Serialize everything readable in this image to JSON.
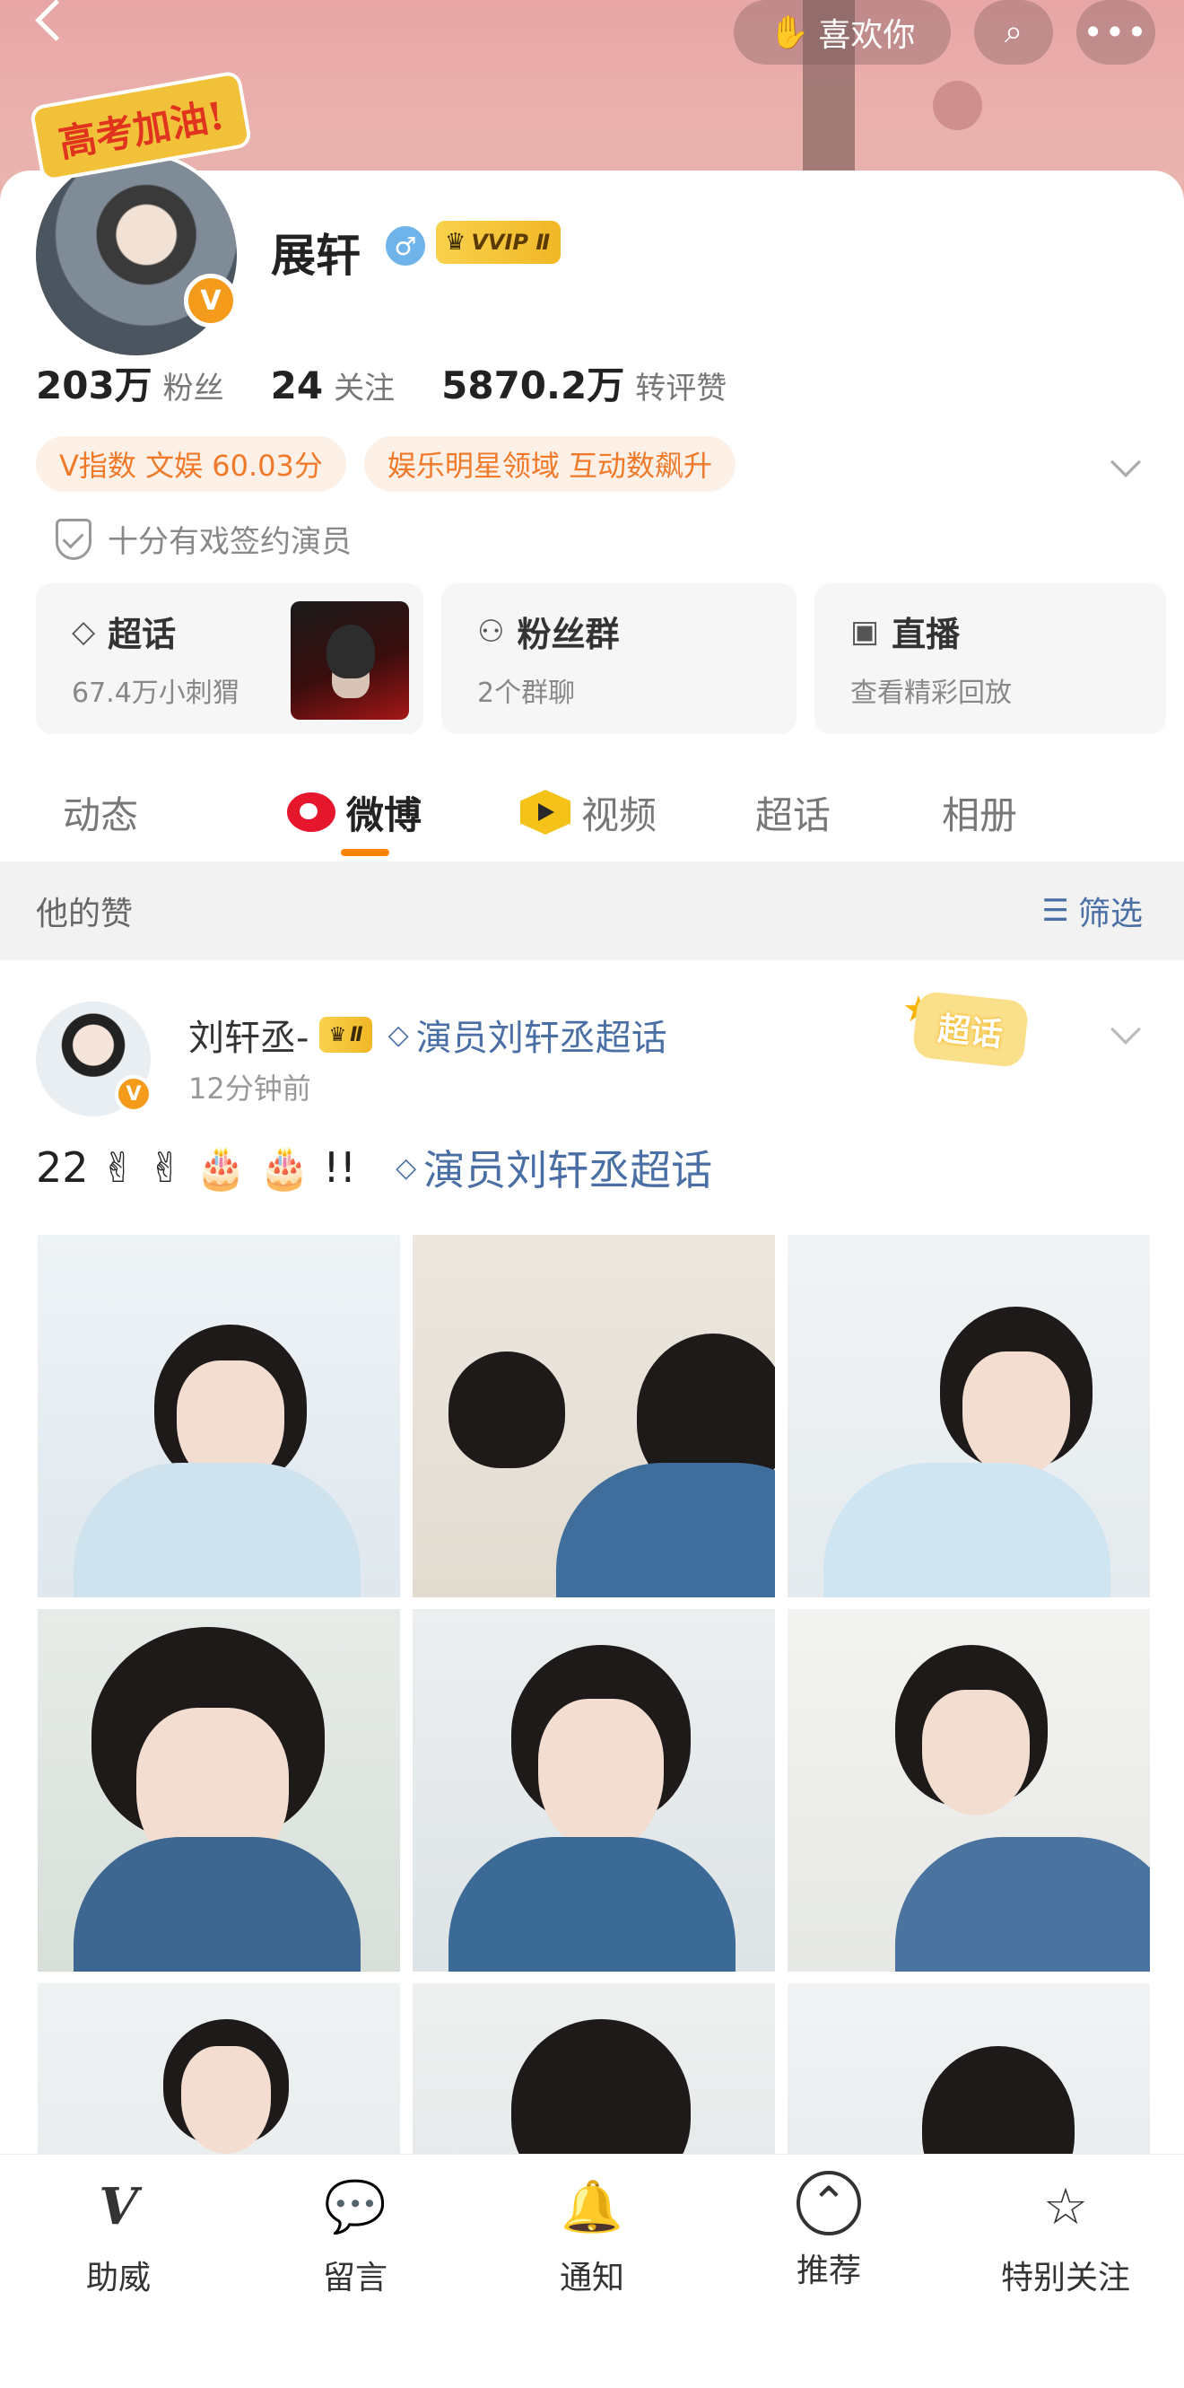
{
  "header": {
    "like_label": "喜欢你",
    "sticker_text": "高考加油!"
  },
  "profile": {
    "name": "展轩",
    "gender_symbol": "♂",
    "vip_label": "VVIP Ⅱ",
    "avatar_badge": "V",
    "stats": [
      {
        "value": "203万",
        "label": "粉丝"
      },
      {
        "value": "24",
        "label": "关注"
      },
      {
        "value": "5870.2万",
        "label": "转评赞"
      }
    ],
    "tags": [
      "V指数 文娱 60.03分",
      "娱乐明星领域 互动数飙升"
    ],
    "verification": "十分有戏签约演员"
  },
  "features": [
    {
      "title": "超话",
      "icon": "diamond-icon",
      "glyph": "◇",
      "subtitle": "67.4万小刺猬"
    },
    {
      "title": "粉丝群",
      "icon": "group-icon",
      "glyph": "⚇",
      "subtitle": "2个群聊"
    },
    {
      "title": "直播",
      "icon": "tv-icon",
      "glyph": "▣",
      "subtitle": "查看精彩回放"
    }
  ],
  "tabs": [
    {
      "label": "动态",
      "active": false
    },
    {
      "label": "微博",
      "active": true
    },
    {
      "label": "视频",
      "active": false
    },
    {
      "label": "超话",
      "active": false
    },
    {
      "label": "相册",
      "active": false
    }
  ],
  "filter_bar": {
    "title": "他的赞",
    "filter_label": "筛选"
  },
  "post": {
    "author": "刘轩丞-",
    "author_vip": "Ⅱ",
    "author_badge": "V",
    "topic": "演员刘轩丞超话",
    "time": "12分钟前",
    "supertag": "超话",
    "text_prefix": "22",
    "emojis": [
      "✌",
      "✌",
      "🎂",
      "🎂"
    ],
    "text_suffix": "!!",
    "text_topic": "演员刘轩丞超话",
    "photo_count": 9
  },
  "bottom_bar": [
    {
      "label": "助威",
      "icon": "cheer-icon",
      "glyph": "V"
    },
    {
      "label": "留言",
      "icon": "message-icon",
      "glyph": "💬"
    },
    {
      "label": "通知",
      "icon": "bell-icon",
      "glyph": "🔔"
    },
    {
      "label": "推荐",
      "icon": "recommend-icon",
      "glyph": "⌃"
    },
    {
      "label": "特别关注",
      "icon": "special-follow-icon",
      "glyph": "☆"
    }
  ],
  "colors": {
    "accent_orange": "#ff8200",
    "link_blue": "#4a6fa5",
    "tag_text": "#f07a2a",
    "tag_bg": "#fdf0e6",
    "vip_gold": "#f1b726"
  }
}
